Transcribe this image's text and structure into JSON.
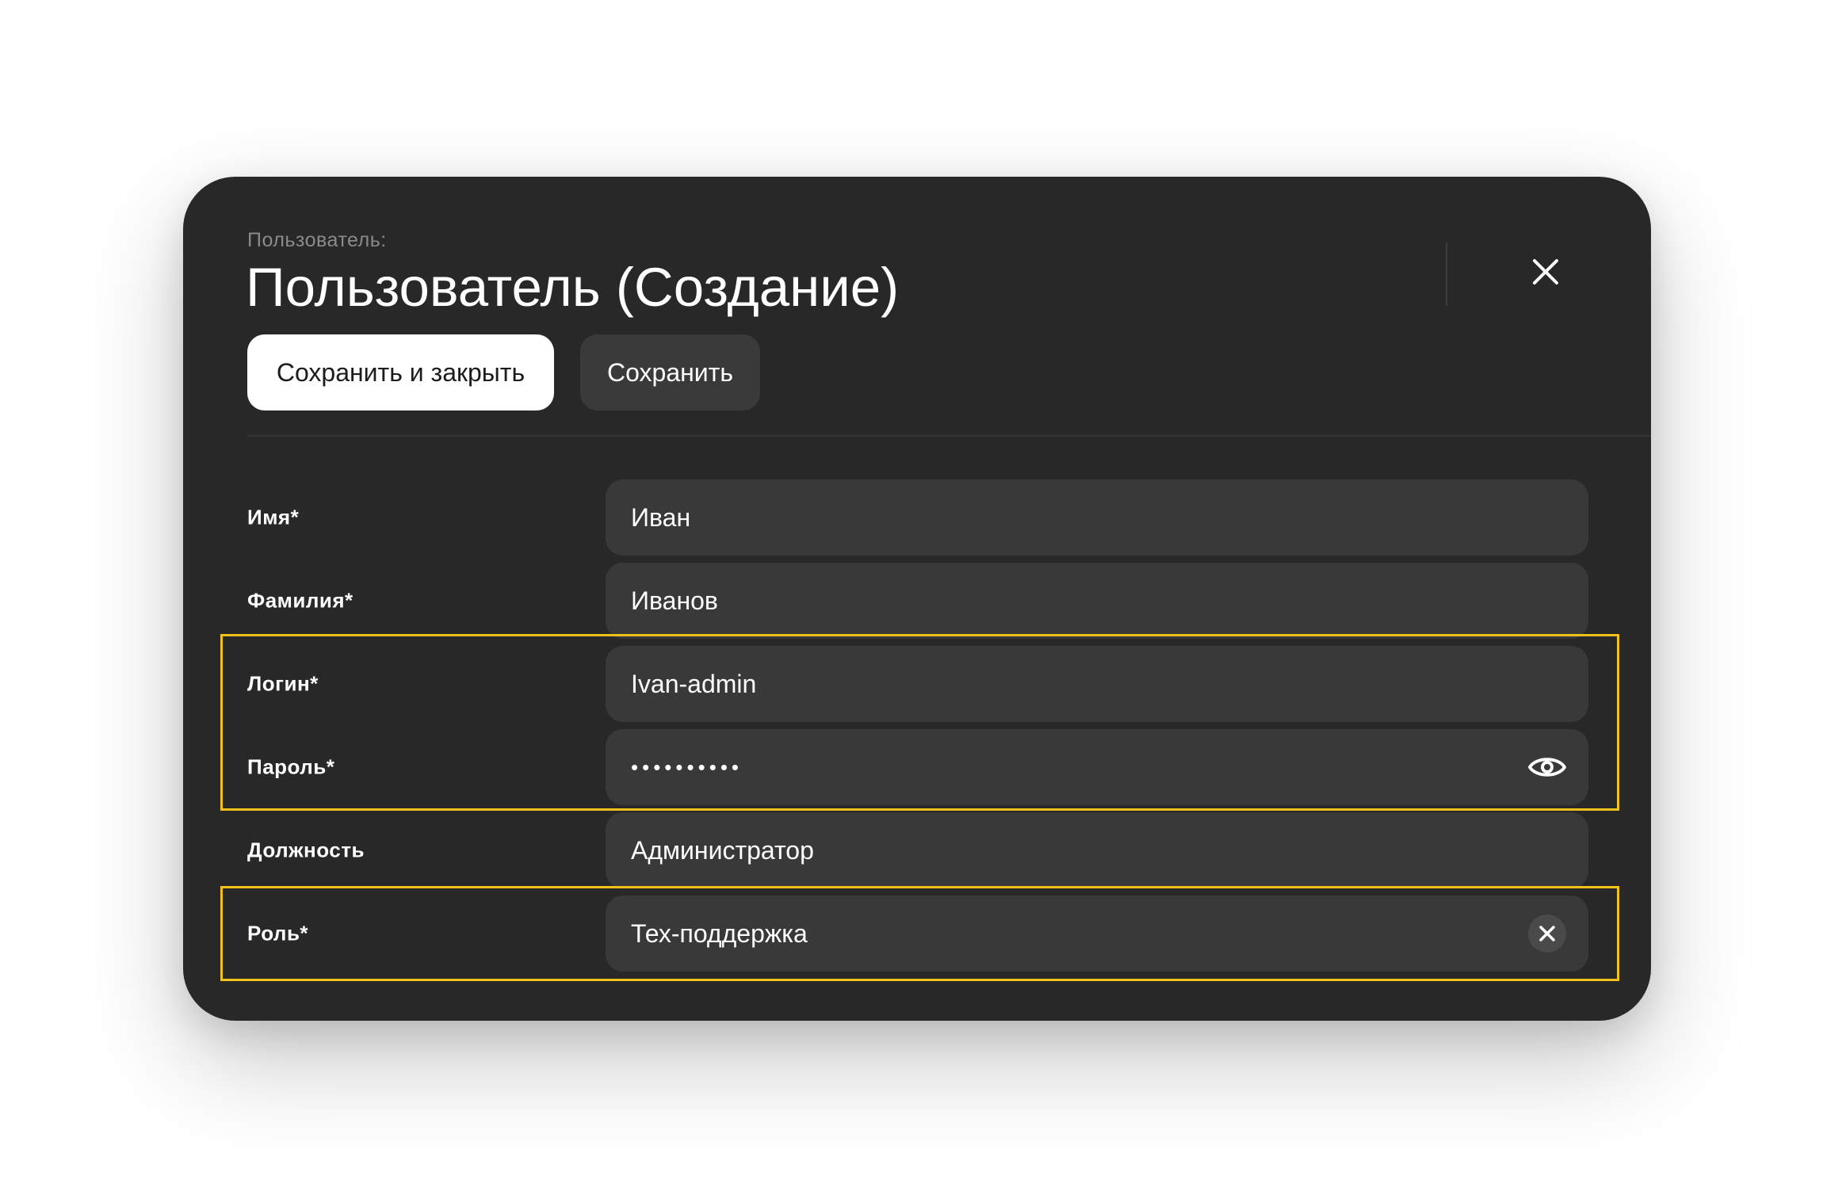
{
  "header": {
    "subtitle": "Пользователь:",
    "title": "Пользователь (Создание)"
  },
  "actions": {
    "save_close_label": "Сохранить и закрыть",
    "save_label": "Сохранить"
  },
  "icons": {
    "close": "close-icon",
    "password_toggle": "eye-icon",
    "clear_role": "clear-icon"
  },
  "form": {
    "first_name": {
      "label": "Имя*",
      "value": "Иван"
    },
    "last_name": {
      "label": "Фамилия*",
      "value": "Иванов"
    },
    "login": {
      "label": "Логин*",
      "value": "Ivan-admin"
    },
    "password": {
      "label": "Пароль*",
      "masked_value": "••••••••••"
    },
    "position": {
      "label": "Должность",
      "value": "Администратор"
    },
    "role": {
      "label": "Роль*",
      "value": "Тех-поддержка"
    }
  },
  "colors": {
    "modal_background": "#282828",
    "field_background": "#393939",
    "primary_button": "#ffffff",
    "secondary_button": "#3a3a3a",
    "highlight": "#f2c21b"
  }
}
